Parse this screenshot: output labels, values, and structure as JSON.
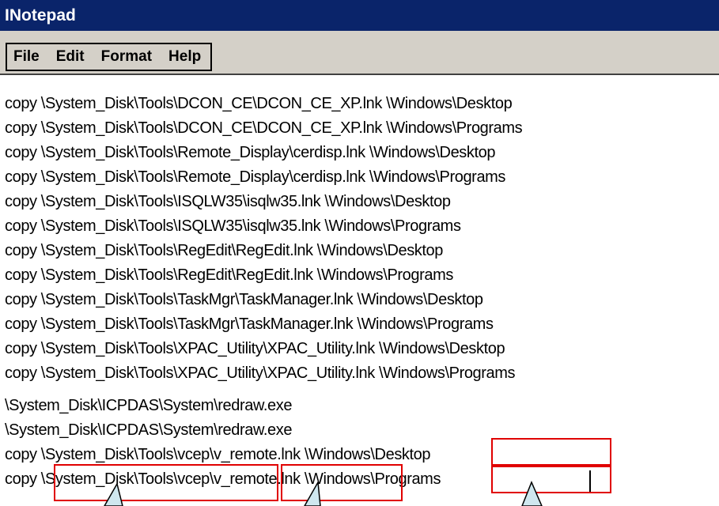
{
  "window": {
    "title": "INotepad"
  },
  "menu": {
    "items": [
      "File",
      "Edit",
      "Format",
      "Help"
    ]
  },
  "editor": {
    "lines": [
      "copy \\System_Disk\\Tools\\DCON_CE\\DCON_CE_XP.lnk \\Windows\\Desktop",
      "copy \\System_Disk\\Tools\\DCON_CE\\DCON_CE_XP.lnk \\Windows\\Programs",
      "copy \\System_Disk\\Tools\\Remote_Display\\cerdisp.lnk \\Windows\\Desktop",
      "copy \\System_Disk\\Tools\\Remote_Display\\cerdisp.lnk \\Windows\\Programs",
      "copy \\System_Disk\\Tools\\ISQLW35\\isqlw35.lnk \\Windows\\Desktop",
      "copy \\System_Disk\\Tools\\ISQLW35\\isqlw35.lnk \\Windows\\Programs",
      "copy \\System_Disk\\Tools\\RegEdit\\RegEdit.lnk \\Windows\\Desktop",
      "copy \\System_Disk\\Tools\\RegEdit\\RegEdit.lnk \\Windows\\Programs",
      "copy \\System_Disk\\Tools\\TaskMgr\\TaskManager.lnk \\Windows\\Desktop",
      "copy \\System_Disk\\Tools\\TaskMgr\\TaskManager.lnk \\Windows\\Programs",
      "copy \\System_Disk\\Tools\\XPAC_Utility\\XPAC_Utility.lnk \\Windows\\Desktop",
      "copy \\System_Disk\\Tools\\XPAC_Utility\\XPAC_Utility.lnk \\Windows\\Programs",
      "\\System_Disk\\ICPDAS\\System\\redraw.exe",
      "\\System_Disk\\ICPDAS\\System\\redraw.exe",
      "copy \\System_Disk\\Tools\\vcep\\v_remote.lnk \\Windows\\Desktop",
      "copy \\System_Disk\\Tools\\vcep\\v_remote.lnk \\Windows\\Programs"
    ]
  },
  "annotations": {
    "highlight_color": "#e00000",
    "callout_color": "#cfe7ef"
  }
}
